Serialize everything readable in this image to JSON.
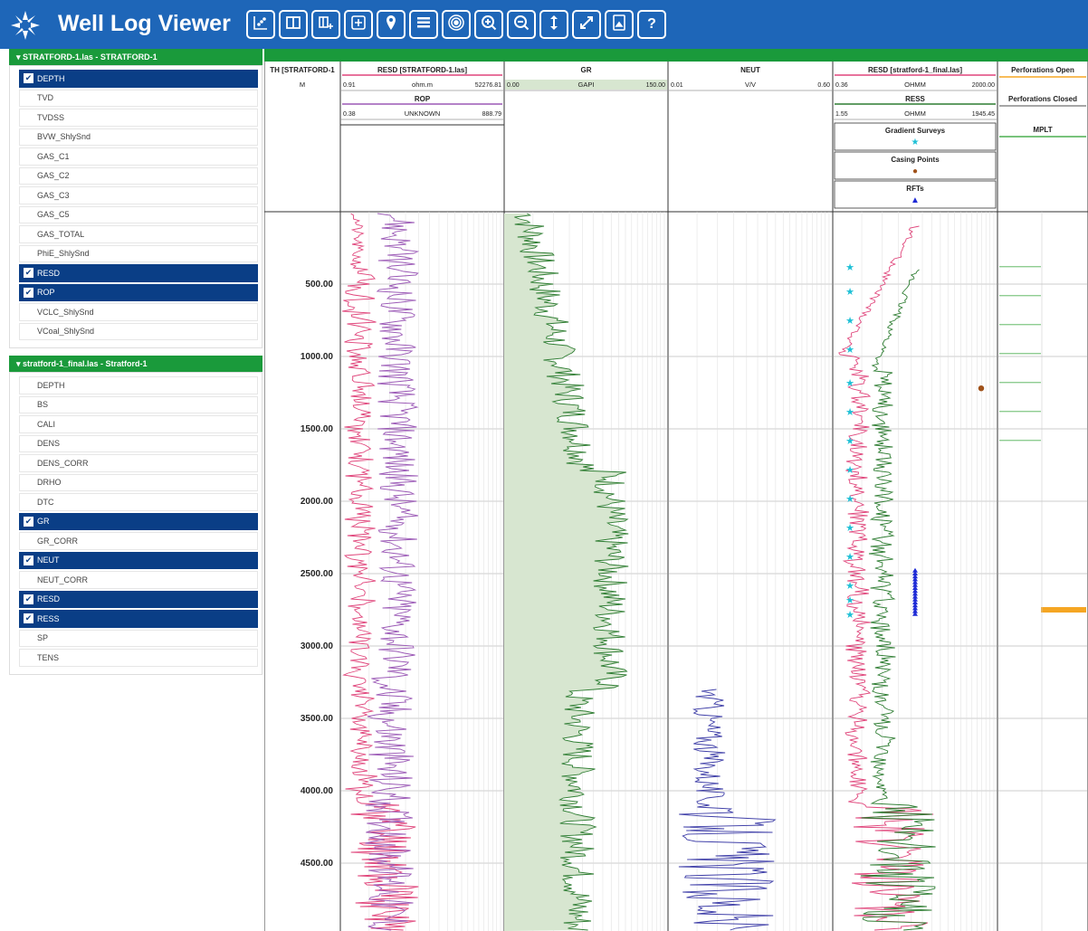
{
  "app": {
    "title": "Well Log Viewer"
  },
  "toolbar": {
    "buttons": [
      {
        "name": "crossplot-icon",
        "glyph": ""
      },
      {
        "name": "columns-icon",
        "glyph": ""
      },
      {
        "name": "add-track-icon",
        "glyph": ""
      },
      {
        "name": "add-panel-icon",
        "glyph": ""
      },
      {
        "name": "location-pin-icon",
        "glyph": ""
      },
      {
        "name": "layers-list-icon",
        "glyph": ""
      },
      {
        "name": "target-icon",
        "glyph": ""
      },
      {
        "name": "zoom-in-icon",
        "glyph": ""
      },
      {
        "name": "zoom-out-icon",
        "glyph": ""
      },
      {
        "name": "vertical-resize-icon",
        "glyph": ""
      },
      {
        "name": "expand-icon",
        "glyph": ""
      },
      {
        "name": "export-image-icon",
        "glyph": ""
      },
      {
        "name": "help-icon",
        "glyph": "?"
      }
    ]
  },
  "sidebar": {
    "groups": [
      {
        "label": "▾ STRATFORD-1.las - STRATFORD-1",
        "items": [
          {
            "label": "DEPTH",
            "checked": true
          },
          {
            "label": "TVD",
            "checked": false
          },
          {
            "label": "TVDSS",
            "checked": false
          },
          {
            "label": "BVW_ShlySnd",
            "checked": false
          },
          {
            "label": "GAS_C1",
            "checked": false
          },
          {
            "label": "GAS_C2",
            "checked": false
          },
          {
            "label": "GAS_C3",
            "checked": false
          },
          {
            "label": "GAS_C5",
            "checked": false
          },
          {
            "label": "GAS_TOTAL",
            "checked": false
          },
          {
            "label": "PhiE_ShlySnd",
            "checked": false
          },
          {
            "label": "RESD",
            "checked": true
          },
          {
            "label": "ROP",
            "checked": true
          },
          {
            "label": "VCLC_ShlySnd",
            "checked": false
          },
          {
            "label": "VCoal_ShlySnd",
            "checked": false
          }
        ]
      },
      {
        "label": "▾ stratford-1_final.las - Stratford-1",
        "items": [
          {
            "label": "DEPTH",
            "checked": false
          },
          {
            "label": "BS",
            "checked": false
          },
          {
            "label": "CALI",
            "checked": false
          },
          {
            "label": "DENS",
            "checked": false
          },
          {
            "label": "DENS_CORR",
            "checked": false
          },
          {
            "label": "DRHO",
            "checked": false
          },
          {
            "label": "DTC",
            "checked": false
          },
          {
            "label": "GR",
            "checked": true
          },
          {
            "label": "GR_CORR",
            "checked": false
          },
          {
            "label": "NEUT",
            "checked": true
          },
          {
            "label": "NEUT_CORR",
            "checked": false
          },
          {
            "label": "RESD",
            "checked": true
          },
          {
            "label": "RESS",
            "checked": true
          },
          {
            "label": "SP",
            "checked": false
          },
          {
            "label": "TENS",
            "checked": false
          }
        ]
      }
    ]
  },
  "tracks": {
    "depth": {
      "title": "TH [STRATFORD-1",
      "unit": "M",
      "ticks": [
        "500.00",
        "1000.00",
        "1500.00",
        "2000.00",
        "2500.00",
        "3000.00",
        "3500.00",
        "4000.00",
        "4500.00"
      ]
    },
    "resd1": {
      "title": "RESD [STRATFORD-1.las]",
      "min": "0.91",
      "unit": "ohm.m",
      "max": "52276.81",
      "color": "#e0457b"
    },
    "rop": {
      "title": "ROP",
      "min": "0.38",
      "unit": "UNKNOWN",
      "max": "888.79",
      "color": "#9b59b6"
    },
    "gr": {
      "title": "GR",
      "min": "0.00",
      "unit": "GAPI",
      "max": "150.00",
      "color": "#2e7d32"
    },
    "neut": {
      "title": "NEUT",
      "min": "0.01",
      "unit": "V/V",
      "max": "0.60",
      "color": "#3f3fa8"
    },
    "resd2": {
      "title": "RESD [stratford-1_final.las]",
      "min": "0.36",
      "unit": "OHMM",
      "max": "2000.00",
      "color": "#e0457b"
    },
    "ress": {
      "title": "RESS",
      "min": "1.55",
      "unit": "OHMM",
      "max": "1945.45",
      "color": "#2e7d32"
    },
    "markers": [
      {
        "title": "Gradient Surveys",
        "symbol": "★",
        "color": "#1ec0d6"
      },
      {
        "title": "Casing Points",
        "symbol": "●",
        "color": "#a0521a"
      },
      {
        "title": "RFTs",
        "symbol": "▲",
        "color": "#1f2bd6"
      }
    ],
    "completion": [
      {
        "title": "Perforations Open",
        "color": "#f5a623"
      },
      {
        "title": "Perforations Closed",
        "color": "#888888"
      },
      {
        "title": "MPLT",
        "color": "#4caf50"
      }
    ]
  },
  "chart_data": {
    "type": "line",
    "depth_range": [
      0,
      5000
    ],
    "gradient_survey_depths": [
      380,
      550,
      750,
      950,
      1180,
      1380,
      1580,
      1780,
      1980,
      2180,
      2380,
      2580,
      2680,
      2780
    ],
    "casing_point_depths": [
      1220
    ],
    "rft_depth_range": [
      2480,
      2780
    ],
    "mplt_depths": [
      380,
      580,
      780,
      980,
      1180,
      1380,
      1580
    ],
    "perforation_open_depth": 2750
  }
}
